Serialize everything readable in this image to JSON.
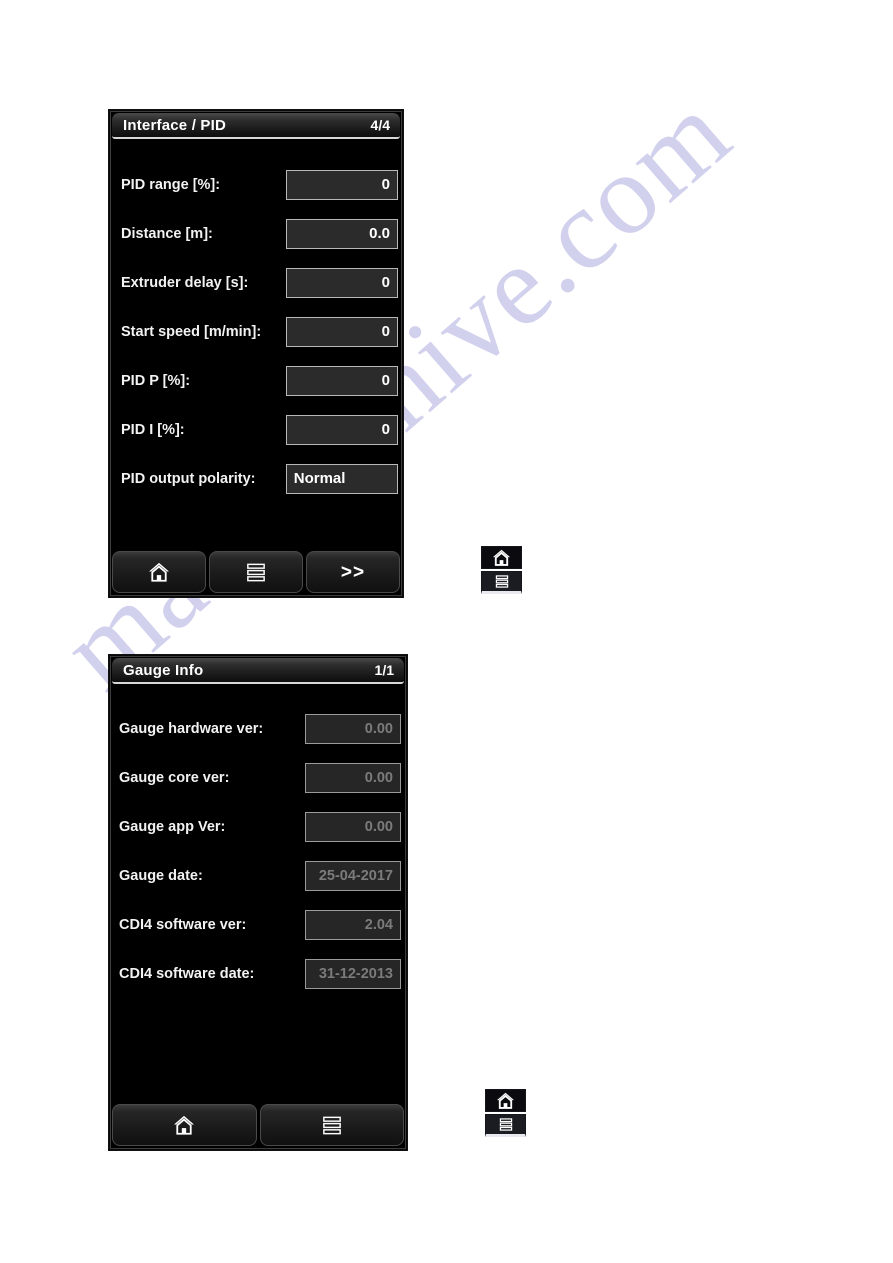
{
  "watermark": {
    "text": "manualshive.com"
  },
  "panels": [
    {
      "id": "interface-pid",
      "title": "Interface / PID",
      "pager": "4/4",
      "rows": [
        {
          "label": "PID range [%]:",
          "value": "0",
          "align": "num",
          "disabled": false
        },
        {
          "label": "Distance [m]:",
          "value": "0.0",
          "align": "num",
          "disabled": false
        },
        {
          "label": "Extruder delay [s]:",
          "value": "0",
          "align": "num",
          "disabled": false
        },
        {
          "label": "Start speed [m/min]:",
          "value": "0",
          "align": "num",
          "disabled": false
        },
        {
          "label": "PID P [%]:",
          "value": "0",
          "align": "num",
          "disabled": false
        },
        {
          "label": "PID I [%]:",
          "value": "0",
          "align": "num",
          "disabled": false
        },
        {
          "label": "PID output polarity:",
          "value": "Normal",
          "align": "text",
          "disabled": false
        }
      ],
      "toolbar": [
        {
          "name": "home-button",
          "icon": "home-icon",
          "label": ""
        },
        {
          "name": "menu-button",
          "icon": "menu-icon",
          "label": ""
        },
        {
          "name": "next-page-button",
          "icon": "chevron-double-right",
          "label": ">>"
        }
      ]
    },
    {
      "id": "gauge-info",
      "title": "Gauge Info",
      "pager": "1/1",
      "rows": [
        {
          "label": "Gauge hardware ver:",
          "value": "0.00",
          "align": "num",
          "disabled": true
        },
        {
          "label": "Gauge core ver:",
          "value": "0.00",
          "align": "num",
          "disabled": true
        },
        {
          "label": "Gauge app Ver:",
          "value": "0.00",
          "align": "num",
          "disabled": true
        },
        {
          "label": "Gauge date:",
          "value": "25-04-2017",
          "align": "num",
          "disabled": true
        },
        {
          "label": "CDI4  software ver:",
          "value": "2.04",
          "align": "num",
          "disabled": true
        },
        {
          "label": "CDI4  software date:",
          "value": "31-12-2013",
          "align": "num",
          "disabled": true
        }
      ],
      "toolbar": [
        {
          "name": "home-button",
          "icon": "home-icon",
          "label": ""
        },
        {
          "name": "menu-button",
          "icon": "menu-icon",
          "label": ""
        }
      ]
    }
  ],
  "callouts": [
    {
      "id": "callout-top",
      "buttons": [
        {
          "icon": "home-icon"
        },
        {
          "icon": "menu-icon"
        }
      ]
    },
    {
      "id": "callout-bottom",
      "buttons": [
        {
          "icon": "home-icon"
        },
        {
          "icon": "menu-icon"
        }
      ]
    }
  ],
  "colors": {
    "panel_background": "#000000",
    "field_background": "#2b2b2b",
    "field_border": "#b9b9b9",
    "label_text": "#f2f2f2",
    "value_text": "#ffffff",
    "disabled_value_text": "#7b7b7b",
    "watermark": "#c9c9ea"
  }
}
